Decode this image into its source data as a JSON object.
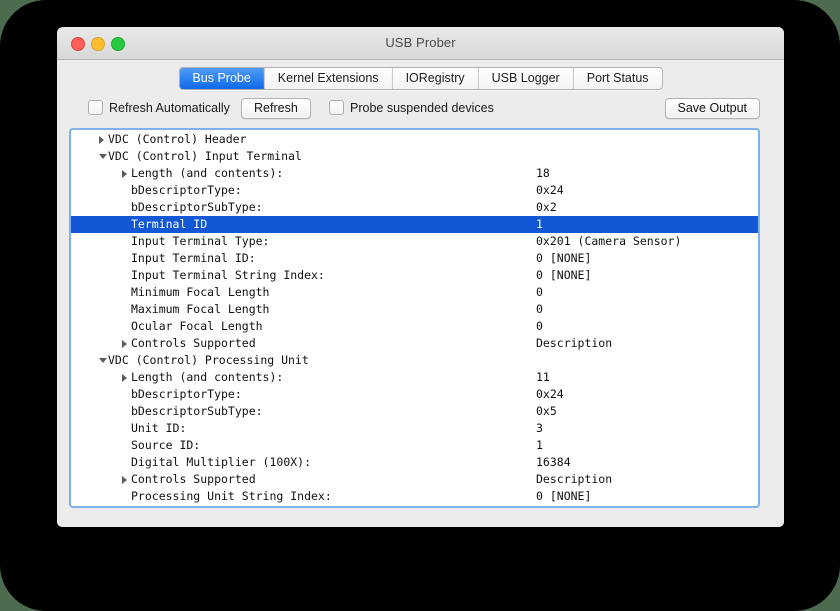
{
  "window": {
    "title": "USB Prober",
    "traffic_lights": [
      {
        "name": "close",
        "color": "#ff5f57"
      },
      {
        "name": "minimize",
        "color": "#ffbd2e"
      },
      {
        "name": "maximize",
        "color": "#28c840"
      }
    ]
  },
  "tabs": [
    {
      "label": "Bus Probe",
      "active": true
    },
    {
      "label": "Kernel Extensions",
      "active": false
    },
    {
      "label": "IORegistry",
      "active": false
    },
    {
      "label": "USB Logger",
      "active": false
    },
    {
      "label": "Port Status",
      "active": false
    }
  ],
  "toolbar": {
    "refresh_automatically_label": "Refresh Automatically",
    "refresh_automatically_checked": false,
    "refresh_button": "Refresh",
    "probe_suspended_label": "Probe suspended devices",
    "probe_suspended_checked": false,
    "save_output_button": "Save Output"
  },
  "tree": {
    "selection_color": "#1257d6",
    "rows": [
      {
        "depth": 1,
        "disclosure": "closed",
        "label": "VDC (Control) Header",
        "value": "",
        "selected": false
      },
      {
        "depth": 1,
        "disclosure": "open",
        "label": "VDC (Control) Input Terminal",
        "value": "",
        "selected": false
      },
      {
        "depth": 2,
        "disclosure": "closed",
        "label": "Length (and contents):",
        "value": "18",
        "selected": false
      },
      {
        "depth": 2,
        "disclosure": "none",
        "label": "bDescriptorType:",
        "value": "0x24",
        "selected": false
      },
      {
        "depth": 2,
        "disclosure": "none",
        "label": "bDescriptorSubType:",
        "value": "0x2",
        "selected": false
      },
      {
        "depth": 2,
        "disclosure": "none",
        "label": "Terminal ID",
        "value": "1",
        "selected": true
      },
      {
        "depth": 2,
        "disclosure": "none",
        "label": "Input Terminal Type:",
        "value": "0x201 (Camera Sensor)",
        "selected": false
      },
      {
        "depth": 2,
        "disclosure": "none",
        "label": "Input Terminal ID:",
        "value": "0 [NONE]",
        "selected": false
      },
      {
        "depth": 2,
        "disclosure": "none",
        "label": "Input Terminal String Index:",
        "value": "0 [NONE]",
        "selected": false
      },
      {
        "depth": 2,
        "disclosure": "none",
        "label": "Minimum Focal Length",
        "value": "0",
        "selected": false
      },
      {
        "depth": 2,
        "disclosure": "none",
        "label": "Maximum Focal Length",
        "value": "0",
        "selected": false
      },
      {
        "depth": 2,
        "disclosure": "none",
        "label": "Ocular Focal Length",
        "value": "0",
        "selected": false
      },
      {
        "depth": 2,
        "disclosure": "closed",
        "label": "Controls Supported",
        "value": "Description",
        "selected": false
      },
      {
        "depth": 1,
        "disclosure": "open",
        "label": "VDC (Control) Processing Unit",
        "value": "",
        "selected": false
      },
      {
        "depth": 2,
        "disclosure": "closed",
        "label": "Length (and contents):",
        "value": "11",
        "selected": false
      },
      {
        "depth": 2,
        "disclosure": "none",
        "label": "bDescriptorType:",
        "value": "0x24",
        "selected": false
      },
      {
        "depth": 2,
        "disclosure": "none",
        "label": "bDescriptorSubType:",
        "value": "0x5",
        "selected": false
      },
      {
        "depth": 2,
        "disclosure": "none",
        "label": "Unit ID:",
        "value": "3",
        "selected": false
      },
      {
        "depth": 2,
        "disclosure": "none",
        "label": "Source ID:",
        "value": "1",
        "selected": false
      },
      {
        "depth": 2,
        "disclosure": "none",
        "label": "Digital Multiplier (100X):",
        "value": "16384",
        "selected": false
      },
      {
        "depth": 2,
        "disclosure": "closed",
        "label": "Controls Supported",
        "value": "Description",
        "selected": false
      },
      {
        "depth": 2,
        "disclosure": "none",
        "label": "Processing Unit String Index:",
        "value": "0 [NONE]",
        "selected": false
      }
    ]
  }
}
